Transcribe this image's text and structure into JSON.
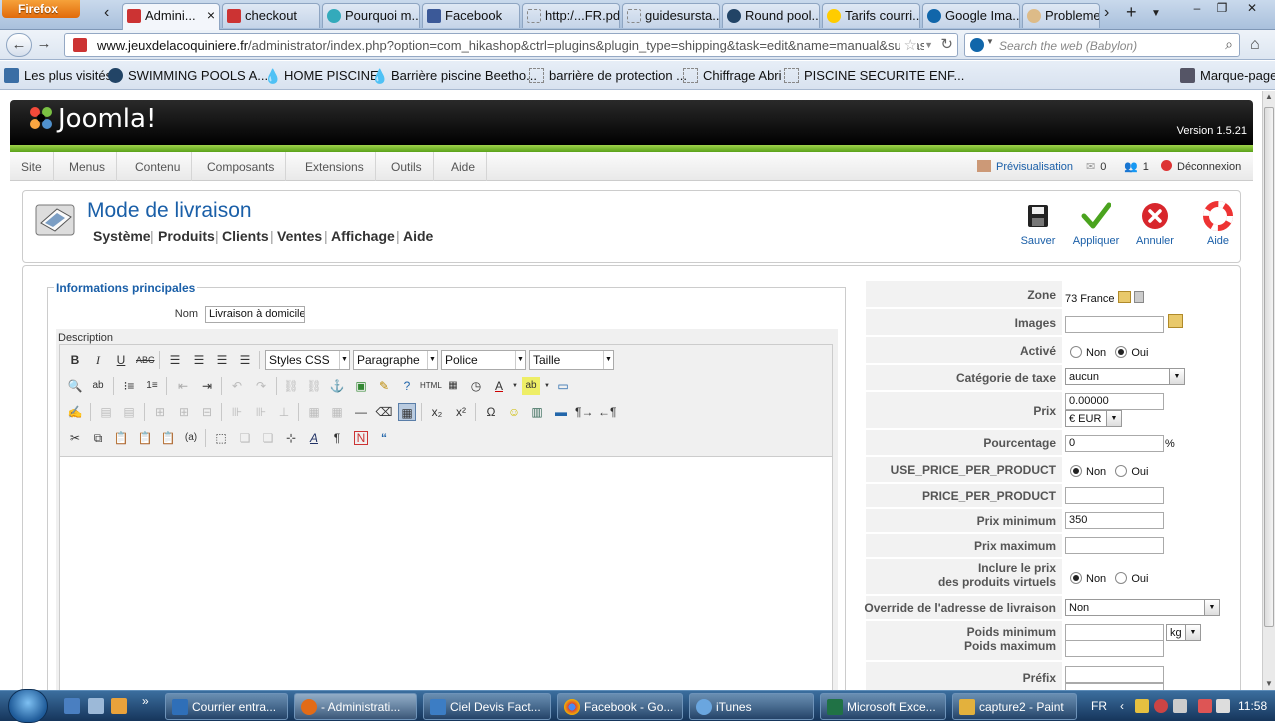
{
  "browser": {
    "app_button": "Firefox",
    "tabs": [
      {
        "label": "Admini...",
        "active": true
      },
      {
        "label": "checkout"
      },
      {
        "label": "Pourquoi m..."
      },
      {
        "label": "Facebook"
      },
      {
        "label": "http:/...FR.pdf"
      },
      {
        "label": "guidesursta..."
      },
      {
        "label": "Round pool..."
      },
      {
        "label": "Tarifs courri..."
      },
      {
        "label": "Google Ima..."
      },
      {
        "label": "Probleme..."
      }
    ],
    "url_domain": "www.jeuxdelacoquiniere.fr",
    "url_rest": "/administrator/index.php?option=com_hikashop&ctrl=plugins&plugin_type=shipping&task=edit&name=manual&subtask",
    "search_placeholder": "Search the web (Babylon)",
    "bookmarks": [
      "Les plus visités",
      "SWIMMING POOLS A...",
      "HOME PISCINE",
      "Barrière piscine Beetho...",
      "barrière de protection ...",
      "Chiffrage Abri",
      "PISCINE SECURITE ENF...",
      "Marque-pages"
    ]
  },
  "joomla": {
    "logo": "Joomla!",
    "version": "Version 1.5.21",
    "menu": [
      "Site",
      "Menus",
      "Contenu",
      "Composants",
      "Extensions",
      "Outils",
      "Aide"
    ],
    "preview": "Prévisualisation",
    "messages_count": "0",
    "users_count": "1",
    "logout": "Déconnexion"
  },
  "page": {
    "title": "Mode de livraison",
    "submenu": [
      "Système",
      "Produits",
      "Clients",
      "Ventes",
      "Affichage",
      "Aide"
    ],
    "actions": {
      "save": "Sauver",
      "apply": "Appliquer",
      "cancel": "Annuler",
      "help": "Aide"
    }
  },
  "main_info": {
    "legend": "Informations principales",
    "name_label": "Nom",
    "name_value": "Livraison à domicile",
    "description_label": "Description",
    "editor": {
      "styles": "Styles CSS",
      "format": "Paragraphe",
      "font": "Police",
      "size": "Taille"
    }
  },
  "settings": {
    "zone_label": "Zone",
    "zone_value": "73 France",
    "images_label": "Images",
    "active_label": "Activé",
    "active_value": "Oui",
    "tax_label": "Catégorie de taxe",
    "tax_value": "aucun",
    "price_label": "Prix",
    "price_value": "0.00000",
    "currency_value": "€ EUR",
    "percent_label": "Pourcentage",
    "percent_value": "0",
    "percent_unit": "%",
    "use_price_label": "USE_PRICE_PER_PRODUCT",
    "use_price_value": "Non",
    "price_per_product_label": "PRICE_PER_PRODUCT",
    "min_price_label": "Prix minimum",
    "min_price_value": "350",
    "max_price_label": "Prix maximum",
    "virtual_label_1": "Inclure le prix",
    "virtual_label_2": "des produits virtuels",
    "virtual_value": "Non",
    "override_label": "Override de l'adresse de livraison",
    "override_value": "Non",
    "min_weight_label": "Poids minimum",
    "max_weight_label": "Poids maximum",
    "weight_unit": "kg",
    "prefix_label": "Préfix",
    "opt_non": "Non",
    "opt_oui": "Oui"
  },
  "taskbar": {
    "items": [
      "Courrier entra...",
      "- Administrati...",
      "Ciel Devis Fact...",
      "Facebook - Go...",
      "iTunes",
      "Microsoft Exce...",
      "capture2 - Paint"
    ],
    "lang": "FR",
    "time": "11:58"
  }
}
